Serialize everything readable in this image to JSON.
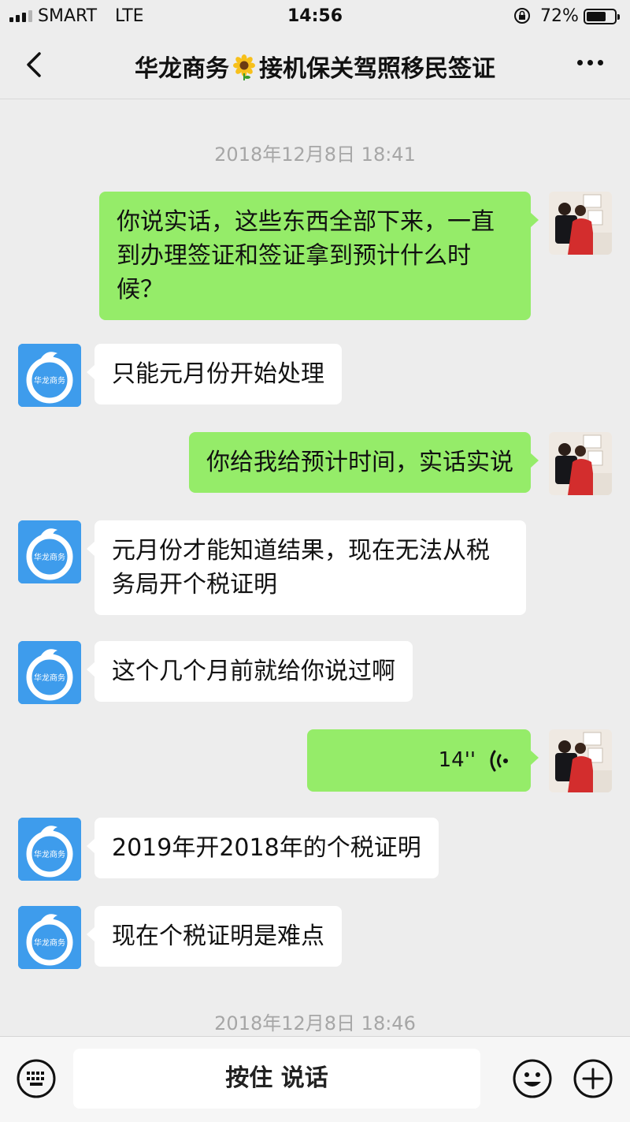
{
  "status_bar": {
    "carrier": "SMART",
    "network": "LTE",
    "time": "14:56",
    "battery_percent": "72%",
    "battery_level": 0.72
  },
  "nav": {
    "title_part1": "华龙商务",
    "title_part2": "接机保关驾照移民签证",
    "back_icon": "chevron-left-icon",
    "more_icon": "more-dots-icon"
  },
  "timestamps": [
    "2018年12月8日 18:41",
    "2018年12月8日 18:46"
  ],
  "messages": [
    {
      "side": "right",
      "text": "你说实话，这些东西全部下来，一直到办理签证和签证拿到预计什么时候？"
    },
    {
      "side": "left",
      "text": "只能元月份开始处理"
    },
    {
      "side": "right",
      "text": "你给我给预计时间，实话实说"
    },
    {
      "side": "left",
      "text": "元月份才能知道结果，现在无法从税务局开个税证明"
    },
    {
      "side": "left",
      "text": "这个几个月前就给你说过啊"
    },
    {
      "side": "right",
      "type": "voice",
      "duration": "14''"
    },
    {
      "side": "left",
      "text": "2019年开2018年的个税证明"
    },
    {
      "side": "left",
      "text": "现在个税证明是难点"
    }
  ],
  "avatar_logo_text": "华龙商务",
  "input_bar": {
    "hold_to_talk": "按住 说话",
    "keyboard_icon": "keyboard-icon",
    "emoji_icon": "emoji-icon",
    "plus_icon": "plus-circle-icon"
  },
  "colors": {
    "background": "#ededed",
    "bubble_self": "#95ec69",
    "bubble_other": "#ffffff",
    "avatar_blue": "#3e9cec"
  }
}
